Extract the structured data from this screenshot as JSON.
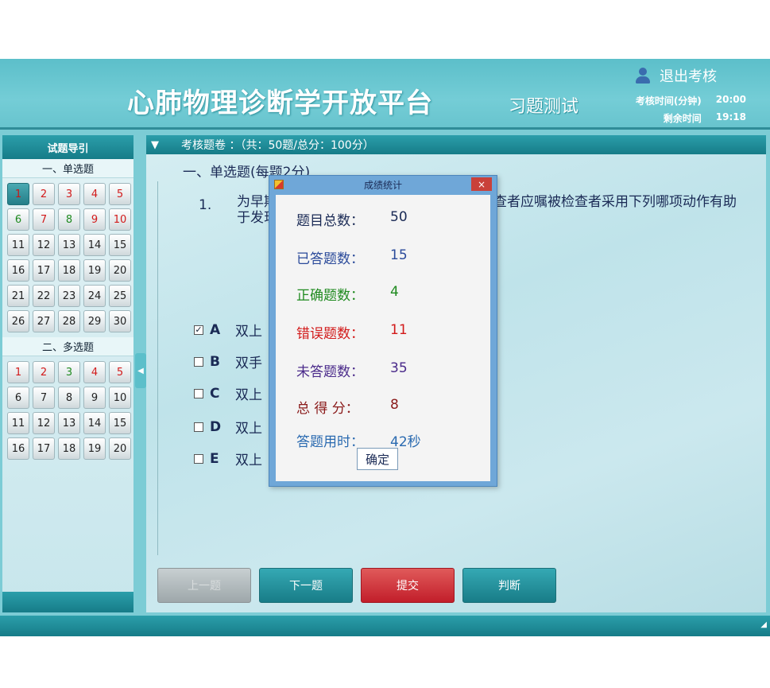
{
  "header": {
    "title": "心肺物理诊断学开放平台",
    "subtitle": "习题测试",
    "logout_label": "退出考核",
    "exam_time_label": "考核时间(分钟)",
    "exam_time_value": "20:00",
    "remaining_label": "剩余时间",
    "remaining_value": "19:18"
  },
  "sidebar": {
    "title": "试题导引",
    "section1_title": "一、单选题",
    "section2_title": "二、多选题"
  },
  "paper": {
    "title": "考核题卷 ：（共：50题/总分：100分）",
    "section_heading": "一、单选题(每题2分)",
    "question_number": "1.",
    "question_text": "为早期发现乳腺癌，在进行乳房视诊时，检查者应嘱被检查者采用下列哪项动作有助于发现乳房皮肤回缩",
    "options": [
      {
        "letter": "A",
        "text": "双上",
        "checked": true
      },
      {
        "letter": "B",
        "text": "双手",
        "checked": false
      },
      {
        "letter": "C",
        "text": "双上",
        "checked": false
      },
      {
        "letter": "D",
        "text": "双上",
        "checked": false
      },
      {
        "letter": "E",
        "text": "双上",
        "checked": false
      }
    ]
  },
  "buttons": {
    "prev": "上一题",
    "next": "下一题",
    "submit": "提交",
    "judge": "判断"
  },
  "modal": {
    "title": "成绩统计",
    "close": "×",
    "ok": "确定",
    "stats": [
      {
        "label": "题目总数：",
        "value": "50",
        "color": "#1a2a55"
      },
      {
        "label": "已答题数：",
        "value": "15",
        "color": "#2a4a9a"
      },
      {
        "label": "正确题数：",
        "value": "4",
        "color": "#1f8a1f"
      },
      {
        "label": "错误题数：",
        "value": "11",
        "color": "#d21a1a"
      },
      {
        "label": "未答题数：",
        "value": "35",
        "color": "#4a2a8a"
      },
      {
        "label": "总 得 分：",
        "value": "8",
        "color": "#8a1a1a"
      },
      {
        "label": "答题用时：",
        "value": "42秒",
        "color": "#2a6ab0"
      }
    ]
  },
  "colors": {
    "accent": "#2b9eaa",
    "header_bg": "#6bc8d2",
    "submit_red": "#c21e2a"
  }
}
